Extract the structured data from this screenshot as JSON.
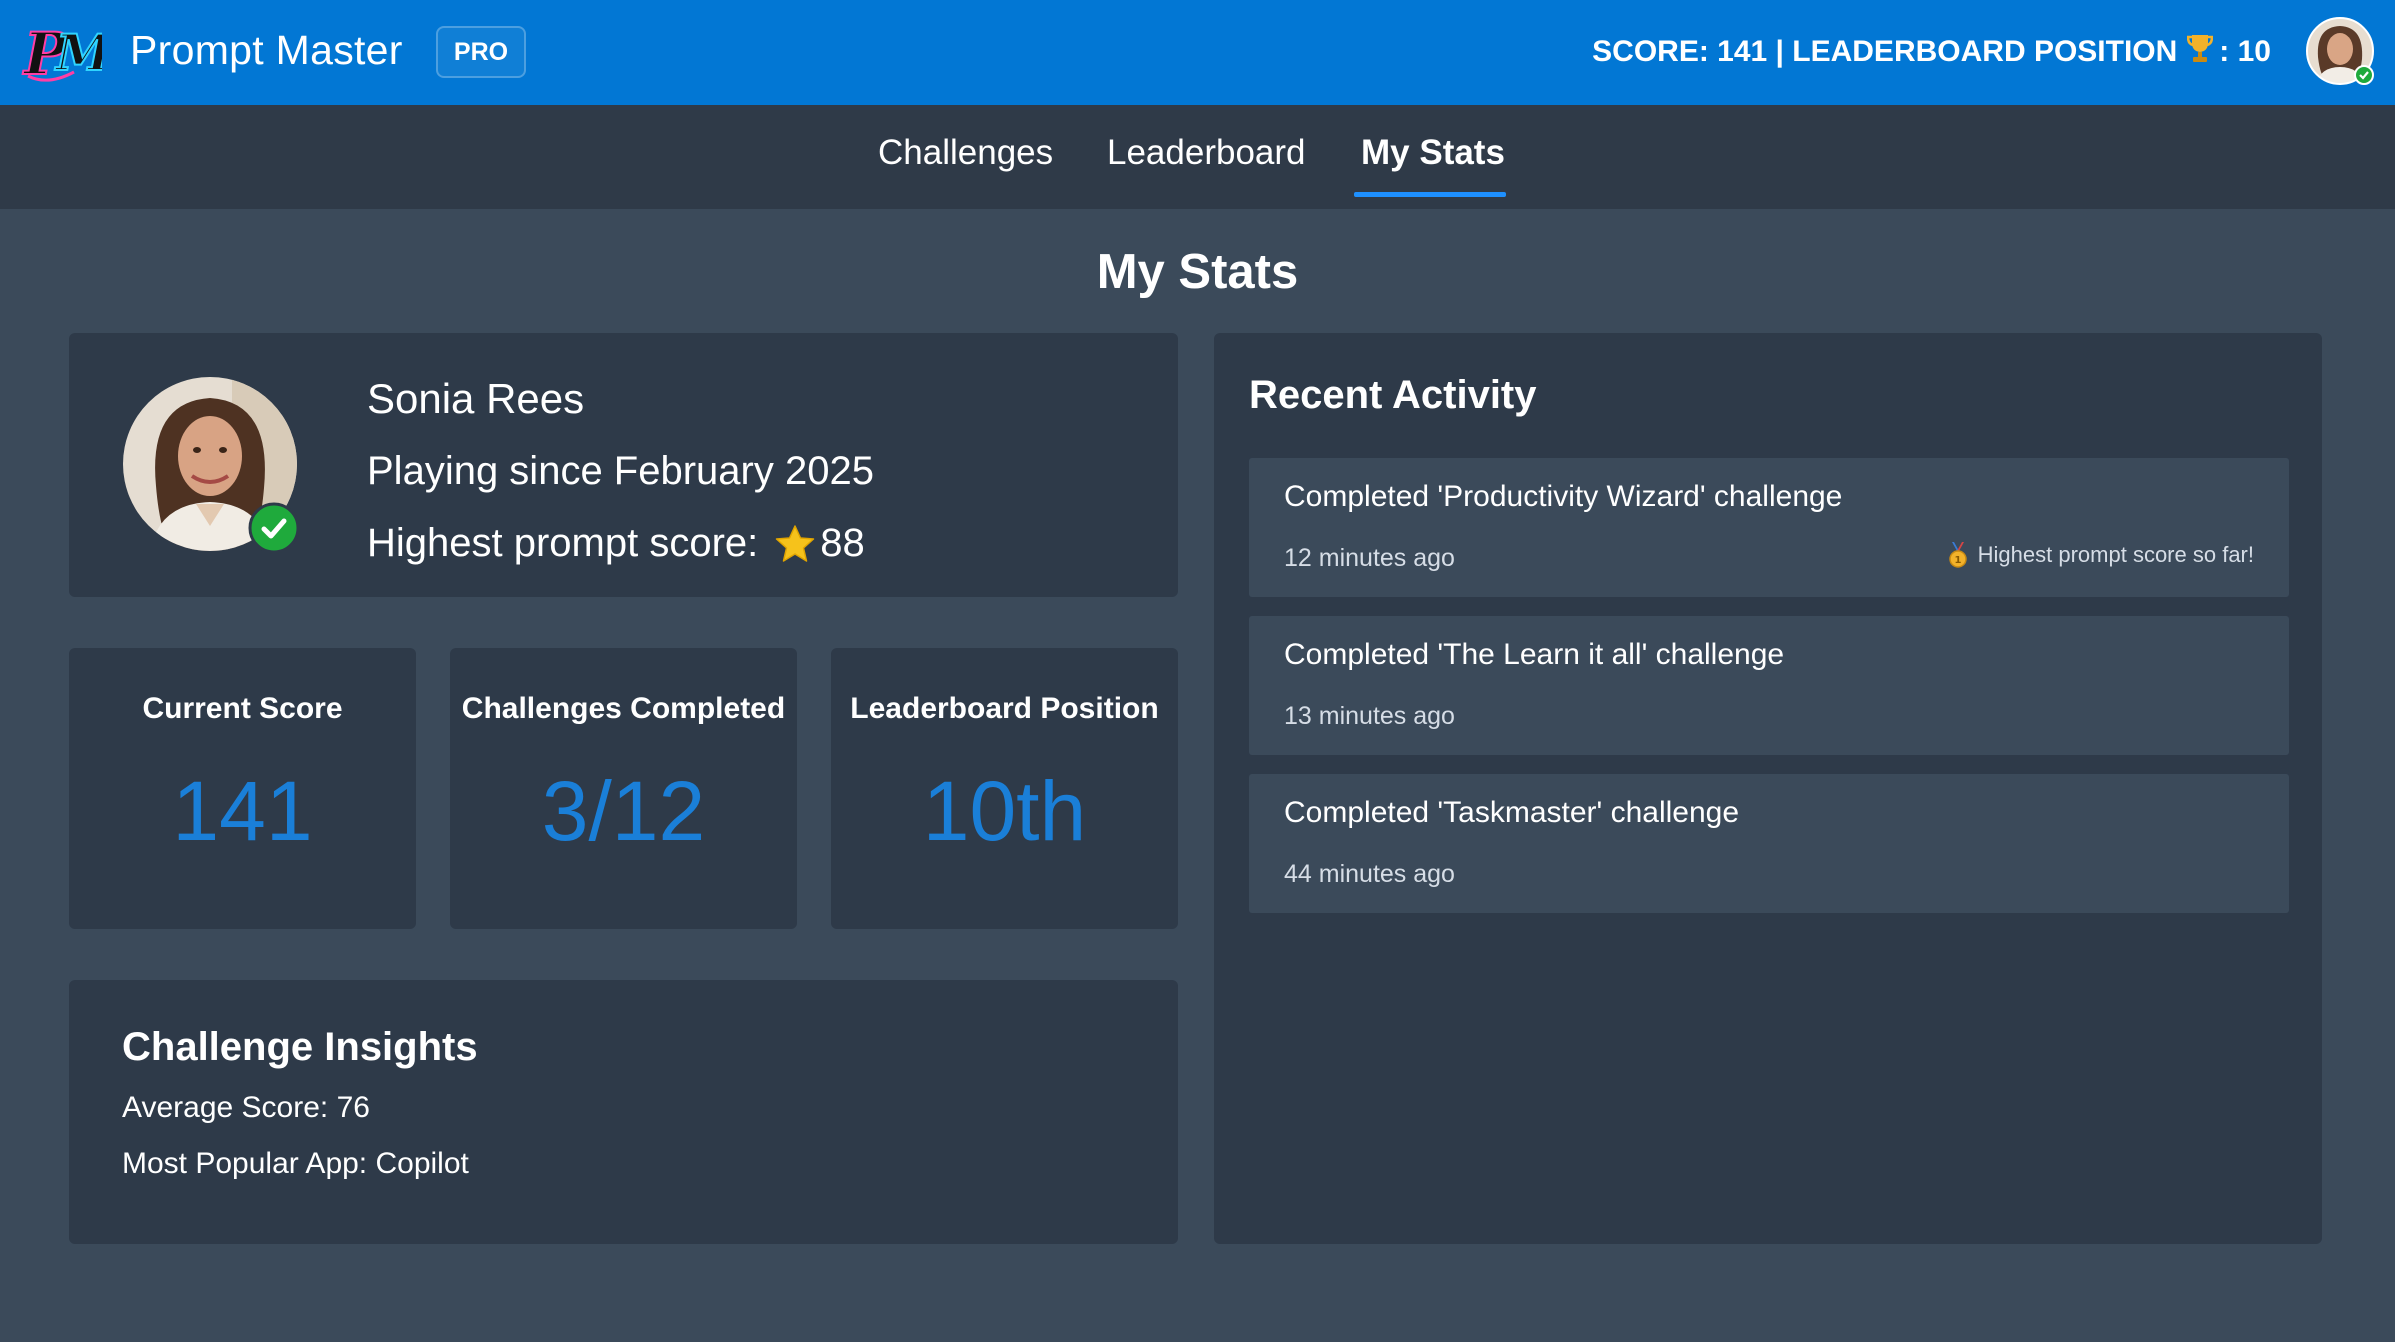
{
  "header": {
    "logo_text": "PM",
    "app_title": "Prompt Master",
    "badge": "PRO",
    "score_text": "SCORE: 141 | LEADERBOARD POSITION",
    "position_text": ": 10",
    "trophy_icon": "trophy-icon",
    "avatar_icon": "user-avatar"
  },
  "nav": {
    "tabs": [
      {
        "label": "Challenges",
        "active": false
      },
      {
        "label": "Leaderboard",
        "active": false
      },
      {
        "label": "My Stats",
        "active": true
      }
    ]
  },
  "page": {
    "title": "My Stats"
  },
  "profile": {
    "name": "Sonia Rees",
    "since": "Playing since February 2025",
    "highest_label": "Highest prompt score:",
    "highest_value": "88",
    "verified_icon": "check-icon"
  },
  "stats": [
    {
      "label": "Current Score",
      "value": "141"
    },
    {
      "label": "Challenges Completed",
      "value": "3/12"
    },
    {
      "label": "Leaderboard Position",
      "value": "10th"
    }
  ],
  "insights": {
    "title": "Challenge Insights",
    "average": "Average Score: 76",
    "popular": "Most Popular App: Copilot"
  },
  "activity": {
    "title": "Recent Activity",
    "items": [
      {
        "text": "Completed 'Productivity Wizard' challenge",
        "time": "12 minutes ago",
        "badge": "Highest prompt score so far!"
      },
      {
        "text": "Completed 'The Learn it all' challenge",
        "time": "13 minutes ago",
        "badge": ""
      },
      {
        "text": "Completed 'Taskmaster' challenge",
        "time": "44 minutes ago",
        "badge": ""
      }
    ]
  },
  "colors": {
    "header_bg": "#0277d4",
    "nav_bg": "#2f3a48",
    "page_bg": "#3b4a5a",
    "card_bg": "#2e3a49",
    "accent": "#1a7fd8",
    "verified_green": "#1faa3c"
  }
}
